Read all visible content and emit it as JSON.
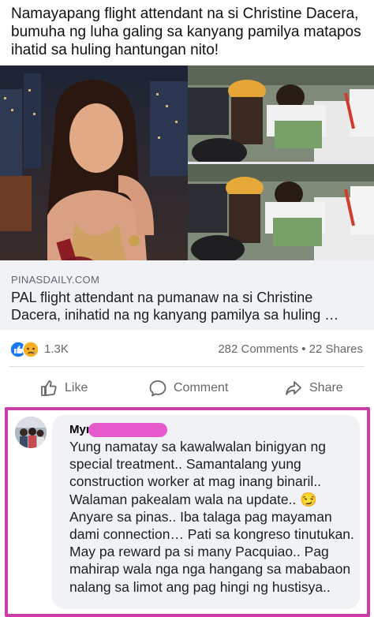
{
  "post": {
    "text": "Namayapang flight attendant na si Christine Dacera, bumuha ng luha galing sa kanyang pamilya matapos ihatid sa huling hantungan nito!"
  },
  "link": {
    "domain": "PINASDAILY.COM",
    "title": "PAL flight attendant na pumanaw na si Christine Dacera, inihatid na ng kanyang pamilya sa huling …"
  },
  "stats": {
    "reaction_count": "1.3K",
    "comments_shares": "282 Comments • 22 Shares"
  },
  "actions": {
    "like_label": "Like",
    "comment_label": "Comment",
    "share_label": "Share"
  },
  "comment": {
    "name": "Myr         pay",
    "text": "Yung namatay sa kawalwalan binigyan ng special treatment.. Samantalang yung construction worker at mag inang binaril.. Walaman pakealam wala na  update.. 😏 Anyare sa pinas.. Iba talaga pag mayaman dami connection… Pati sa kongreso tinutukan. May pa reward pa si many Pacquiao.. Pag mahirap wala nga nga hangang sa mababaon nalang sa limot ang pag hingi ng hustisya.."
  },
  "colors": {
    "highlight_border": "#c93ea7",
    "redaction": "#e75acb",
    "like_blue": "#1877f2",
    "sad_yellow": "#f7b125"
  },
  "icons": [
    "like-reaction-icon",
    "sad-reaction-icon",
    "thumbs-up-icon",
    "comment-bubble-icon",
    "share-arrow-icon"
  ]
}
